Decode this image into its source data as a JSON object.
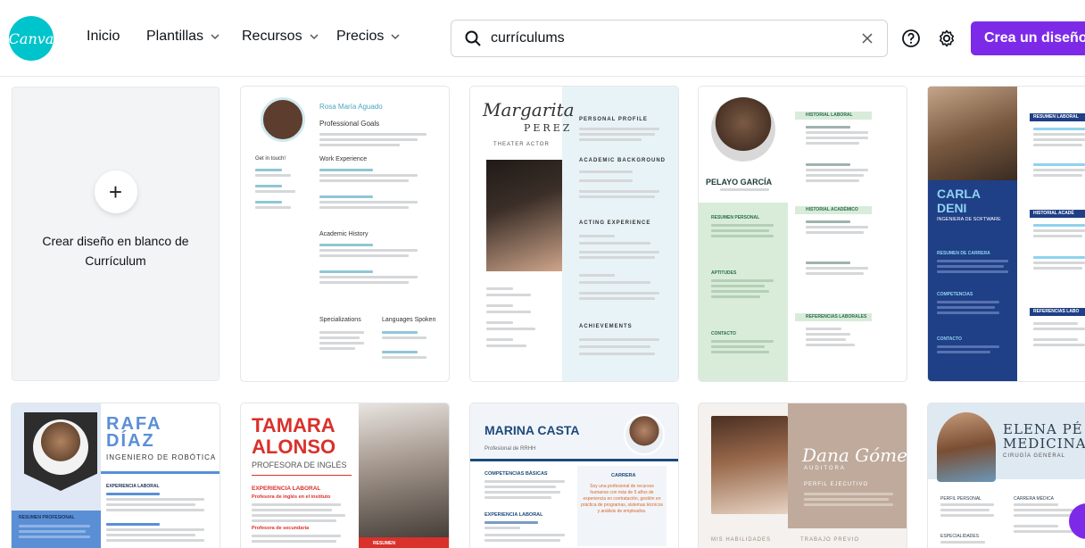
{
  "brand": {
    "logo_text": "Canva",
    "accent": "#7d2ae8",
    "logo_color": "#00c4cc"
  },
  "nav": {
    "home": "Inicio",
    "templates": "Plantillas",
    "resources": "Recursos",
    "pricing": "Precios"
  },
  "search": {
    "value": "currículums",
    "placeholder": ""
  },
  "actions": {
    "cta": "Crea un diseño"
  },
  "blank_card": {
    "label": "Crear diseño en blanco de Currículum"
  },
  "templates": {
    "rosa": {
      "name": "Rosa María Aguado",
      "h1": "Professional Goals",
      "h2": "Work Experience",
      "h3": "Academic History",
      "h4": "Specializations",
      "h5": "Languages Spoken",
      "h6": "Get in touch!"
    },
    "margarita": {
      "first": "Margarita",
      "last": "PEREZ",
      "role": "THEATER ACTOR",
      "s1": "PERSONAL PROFILE",
      "s2": "ACADEMIC BACKGROUND",
      "s3": "ACTING EXPERIENCE",
      "s4": "ACHIEVEMENTS"
    },
    "pelayo": {
      "name": "PELAYO GARCÍA",
      "s1": "HISTORIAL LABORAL",
      "s2": "HISTORIAL ACADÉMICO",
      "s3": "REFERENCIAS LABORALES",
      "s4": "RESUMEN PERSONAL",
      "s5": "APTITUDES",
      "s6": "CONTACTO"
    },
    "carla": {
      "first": "CARLA",
      "last": "DENI",
      "role": "INGENIERA DE SOFTWARE",
      "s1": "RESUMEN DE CARRERA",
      "s2": "COMPETENCIAS",
      "s3": "CONTACTO",
      "r1": "RESUMEN LABORAL",
      "r2": "HISTORIAL ACADÉ",
      "r3": "REFERENCIAS LABO"
    },
    "rafa": {
      "first": "RAFA",
      "last": "DÍAZ",
      "role": "INGENIERO DE ROBÓTICA",
      "s1": "EXPERIENCIA LABORAL",
      "s2": "RESUMEN PROFESIONAL"
    },
    "tamara": {
      "first": "TAMARA",
      "last": "ALONSO",
      "role": "PROFESORA DE INGLÉS",
      "s1": "EXPERIENCIA LABORAL",
      "s2": "Profesora de inglés en el instituto",
      "s3": "Profesora de secundaria",
      "s4": "RESUMEN"
    },
    "marina": {
      "name": "MARINA CASTA",
      "role": "Profesional de RRHH",
      "s1": "COMPETENCIAS BÁSICAS",
      "s2": "CARRERA",
      "s3": "EXPERIENCIA LABORAL",
      "quote": "Soy una profesional de recursos humanos con más de 5 años de experiencia en contratación, gestión en práctica de programas, sistemas técnicos y análisis de empleados."
    },
    "dana": {
      "name": "Dana Gómez",
      "role": "AUDITORA",
      "s1": "PERFIL EJECUTIVO",
      "s2": "MIS HABILIDADES",
      "s3": "TRABAJO PREVIO"
    },
    "elena": {
      "first": "ELENA PÉ",
      "last": "MEDICINA",
      "role": "CIRUGÍA GENERAL",
      "s1": "PERFIL PERSONAL",
      "s2": "CARRERA MÉDICA",
      "s3": "ESPECIALIDADES"
    }
  }
}
